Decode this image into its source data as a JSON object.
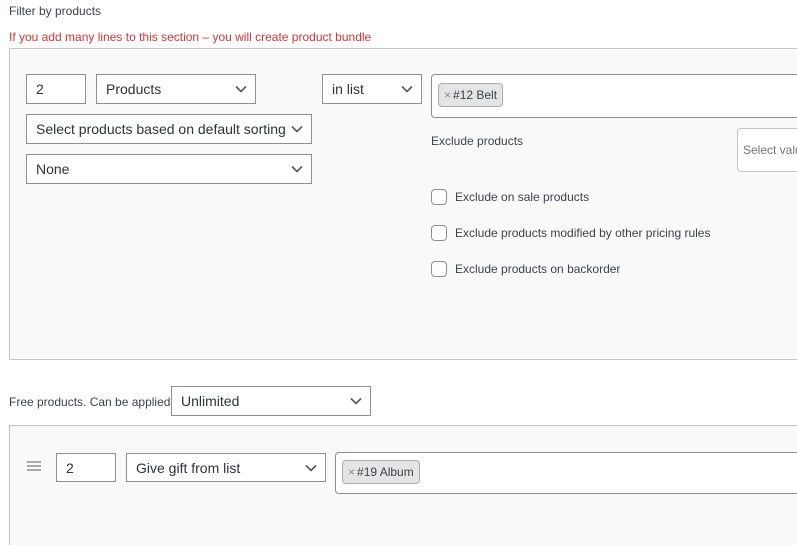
{
  "filter": {
    "title": "Filter by products",
    "warning": "If you add many lines to this section – you will create product bundle",
    "quantity": "2",
    "type_select": "Products",
    "condition_select": "in list",
    "sorting_select": "Select products based on default sorting",
    "extra_select": "None",
    "selected_tags": [
      "#12 Belt"
    ],
    "exclude_label": "Exclude products",
    "exclude_placeholder": "Select values",
    "checkboxes": [
      {
        "label": "Exclude on sale products",
        "checked": false
      },
      {
        "label": "Exclude products modified by other pricing rules",
        "checked": false
      },
      {
        "label": "Exclude products on backorder",
        "checked": false
      }
    ]
  },
  "free": {
    "label": "Free products. Can be applied",
    "limit_select": "Unlimited",
    "quantity": "2",
    "mode_select": "Give gift from list",
    "selected_tags": [
      "#19 Album"
    ]
  },
  "colors": {
    "warning": "#d63638",
    "panel_bg": "#f9f9f9",
    "border": "#8c8f94",
    "tag_bg": "#e4e4e4"
  },
  "icons": [
    "chevron-down-icon",
    "remove-tag-icon",
    "drag-handle-icon"
  ]
}
